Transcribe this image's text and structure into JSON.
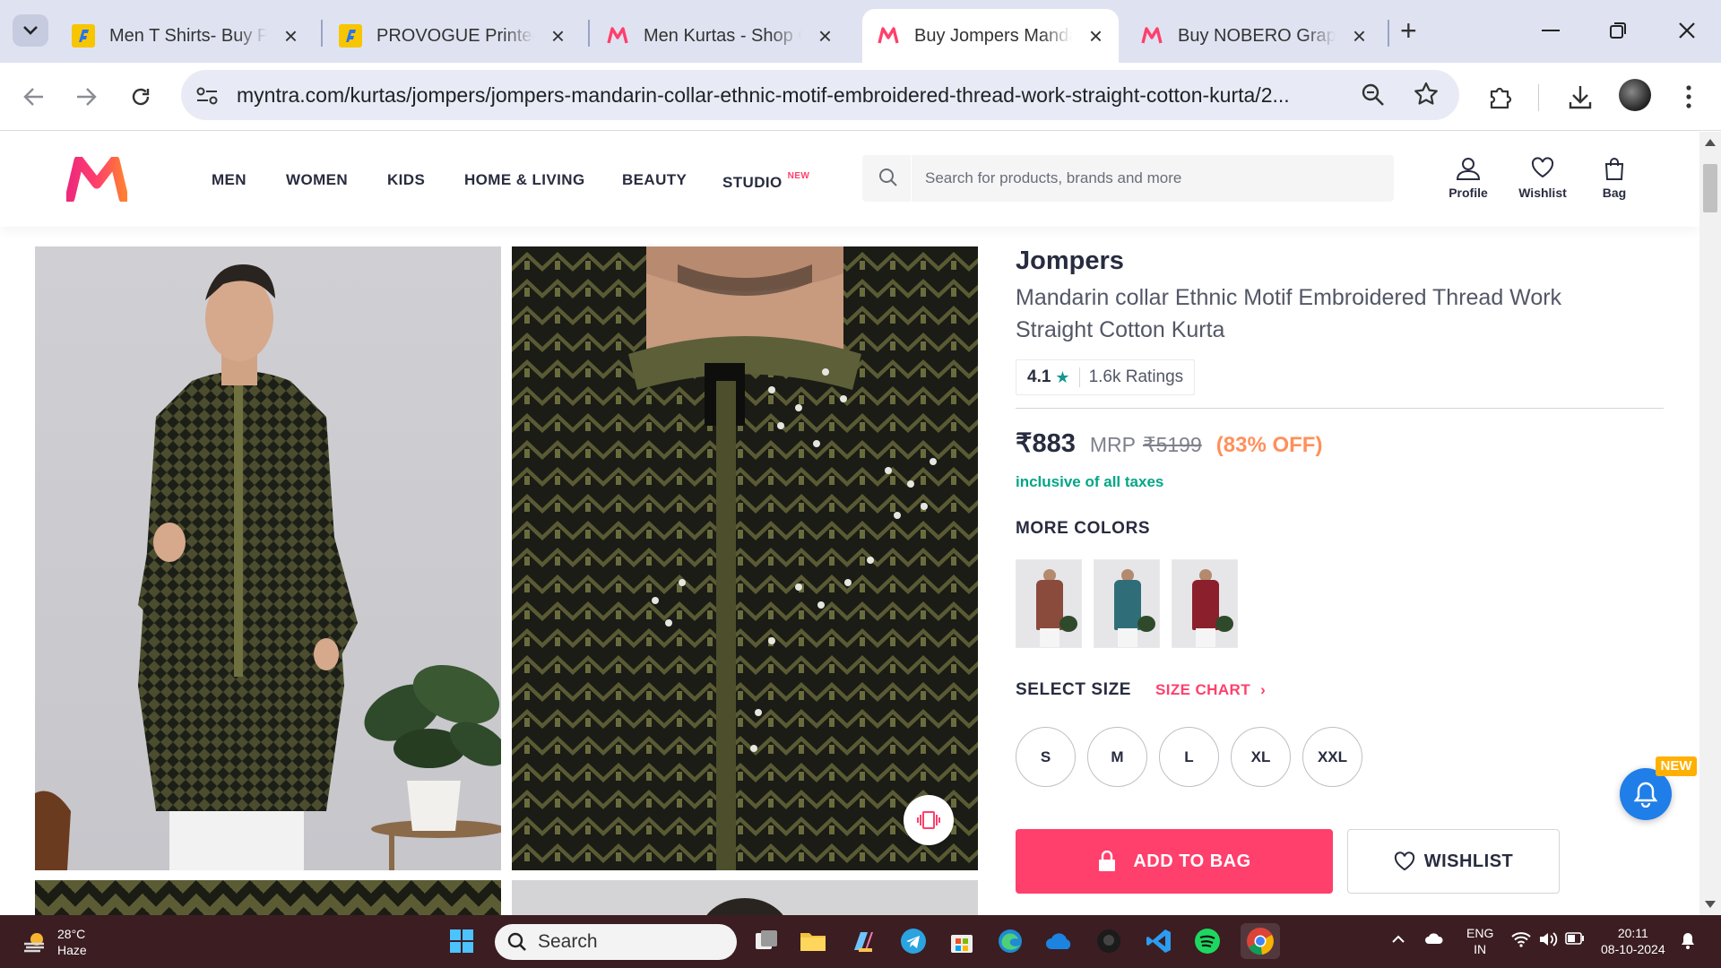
{
  "browser": {
    "tabs": [
      {
        "title": "Men T Shirts- Buy Products Online",
        "favicon": "flipkart"
      },
      {
        "title": "PROVOGUE Printed Men Round Neck",
        "favicon": "flipkart"
      },
      {
        "title": "Men Kurtas - Shop Online",
        "favicon": "myntra"
      },
      {
        "title": "Buy Jompers Mandarin Collar",
        "favicon": "myntra",
        "active": true
      },
      {
        "title": "Buy NOBERO Graphic Print",
        "favicon": "myntra"
      }
    ],
    "new_tab": "+",
    "url": "myntra.com/kurtas/jompers/jompers-mandarin-collar-ethnic-motif-embroidered-thread-work-straight-cotton-kurta/2..."
  },
  "header": {
    "nav": [
      "MEN",
      "WOMEN",
      "KIDS",
      "HOME & LIVING",
      "BEAUTY",
      "STUDIO"
    ],
    "studio_badge": "NEW",
    "search_placeholder": "Search for products, brands and more",
    "profile": "Profile",
    "wishlist": "Wishlist",
    "bag": "Bag"
  },
  "product": {
    "brand": "Jompers",
    "name": "Mandarin collar Ethnic Motif Embroidered Thread Work Straight Cotton Kurta",
    "rating": "4.1",
    "rating_count": "1.6k Ratings",
    "price": "₹883",
    "mrp_label": "MRP",
    "mrp": "₹5199",
    "discount": "(83% OFF)",
    "tax_note": "inclusive of all taxes",
    "more_colors_label": "MORE COLORS",
    "colors": [
      "#8a4a3c",
      "#2f6e78",
      "#8c1f2c"
    ],
    "select_size_label": "SELECT SIZE",
    "size_chart_label": "SIZE CHART",
    "sizes": [
      "S",
      "M",
      "L",
      "XL",
      "XXL"
    ],
    "add_to_bag": "ADD TO BAG",
    "wishlist_btn": "WISHLIST"
  },
  "notification": {
    "badge": "NEW"
  },
  "taskbar": {
    "temp": "28°C",
    "weather": "Haze",
    "search": "Search",
    "lang_top": "ENG",
    "lang_bottom": "IN",
    "time": "20:11",
    "date": "08-10-2024"
  },
  "colors": {
    "accent": "#ff3f6c",
    "rating_star": "#14958f",
    "discount": "#ff905a",
    "tax": "#03a685",
    "taskbar": "#3b1d22"
  }
}
